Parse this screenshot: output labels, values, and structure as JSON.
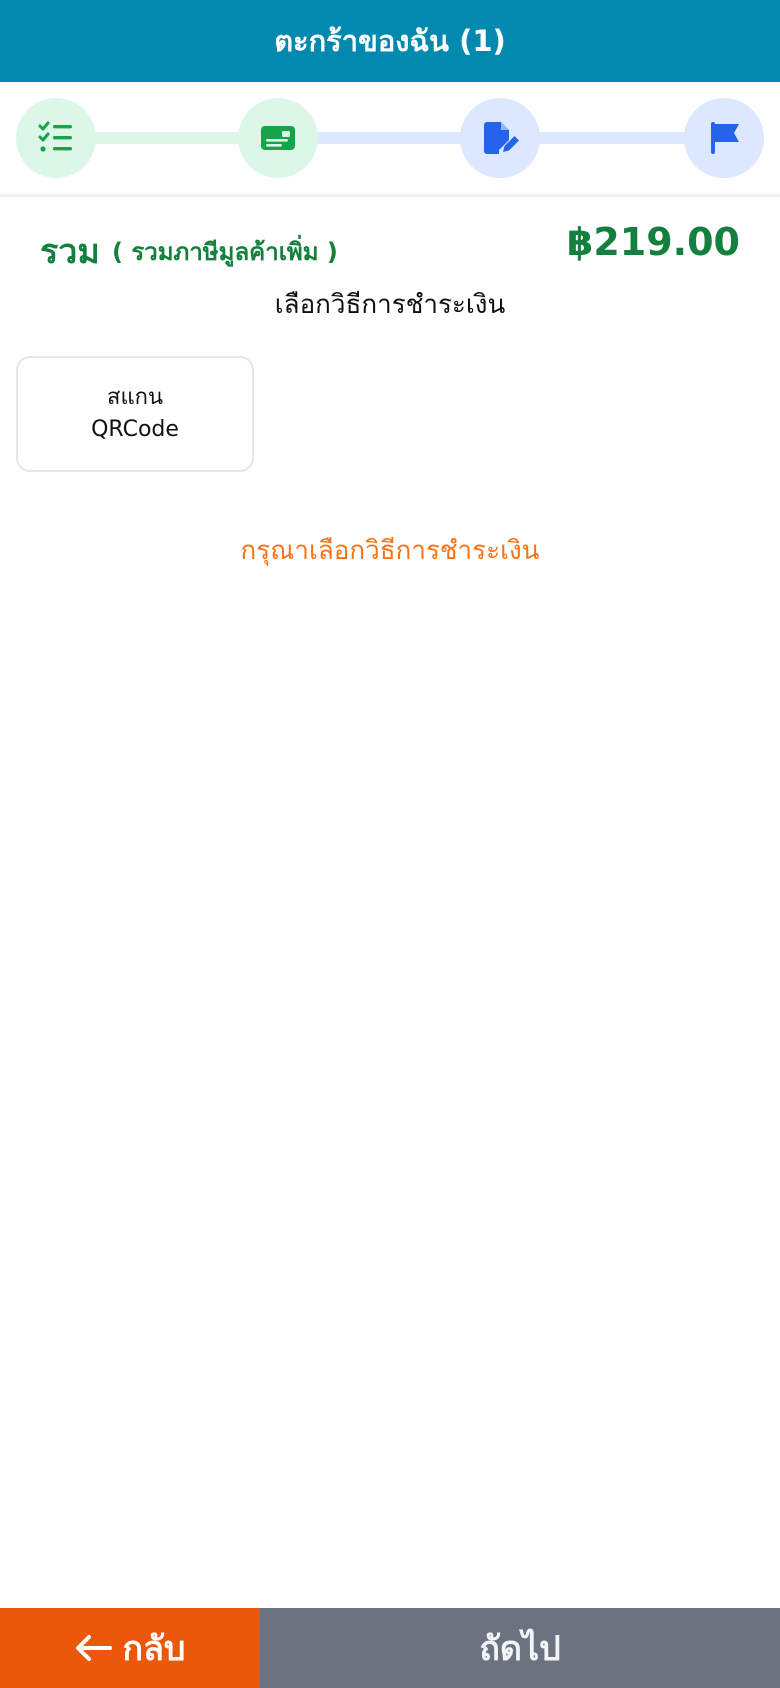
{
  "header": {
    "title": "ตะกร้าของฉัน (1)"
  },
  "stepper": {
    "steps": [
      {
        "icon": "checklist-icon",
        "state": "done",
        "color": "#16a34a"
      },
      {
        "icon": "id-card-icon",
        "state": "active",
        "color": "#16a34a"
      },
      {
        "icon": "file-edit-icon",
        "state": "pending",
        "color": "#2563eb"
      },
      {
        "icon": "flag-icon",
        "state": "pending",
        "color": "#2563eb"
      }
    ]
  },
  "total": {
    "label": "รวม",
    "sublabel": "( รวมภาษีมูลค้าเพิ่ม )",
    "amount": "฿219.00",
    "color": "#15803d"
  },
  "payment": {
    "title": "เลือกวิธีการชำระเงิน",
    "methods": [
      {
        "line1": "สแกน",
        "line2": "QRCode"
      }
    ],
    "warning": "กรุณาเลือกวิธีการชำระเงิน"
  },
  "footer": {
    "back_label": "กลับ",
    "next_label": "ถัดไป",
    "back_color": "#ea580c",
    "next_color": "#6b7280"
  }
}
